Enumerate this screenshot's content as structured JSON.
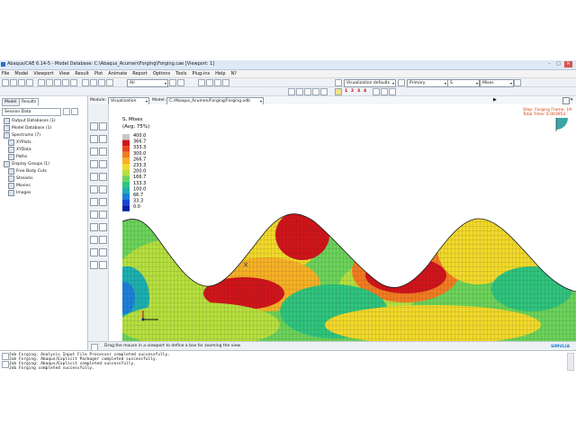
{
  "window": {
    "title": "Abaqus/CAE 6.14-5 - Model Database: C:\\Abaqus_Acumen\\Forging\\Forging.cae [Viewport: 1]",
    "minimize": "–",
    "maximize": "□",
    "close": "✕"
  },
  "menubar": [
    "File",
    "Model",
    "Viewport",
    "View",
    "Result",
    "Plot",
    "Animate",
    "Report",
    "Options",
    "Tools",
    "Plug-ins",
    "Help",
    "N?"
  ],
  "toolbar": {
    "all_select": "All",
    "visualization_defaults": "Visualization defaults",
    "primary": "Primary",
    "variable_s": "S",
    "mises": "Mises",
    "step_numbers": [
      "1",
      "2",
      "3",
      "4"
    ]
  },
  "context": {
    "module_label": "Module:",
    "module_value": "Visualization",
    "model_label": "Model:",
    "model_value": "C:/Abaqus_Acumen/Forging/Forging.odb"
  },
  "left_panel": {
    "tabs": [
      "Model",
      "Results"
    ],
    "session_label": "Session Data",
    "tree": [
      {
        "label": "Output Databases (1)",
        "child": false
      },
      {
        "label": "Model Database (1)",
        "child": false
      },
      {
        "label": "Spectrums (7)",
        "child": false
      },
      {
        "label": "XYPlots",
        "child": true
      },
      {
        "label": "XYData",
        "child": true
      },
      {
        "label": "Paths",
        "child": true
      },
      {
        "label": "Display Groups (1)",
        "child": false
      },
      {
        "label": "Free Body Cuts",
        "child": true
      },
      {
        "label": "Streams",
        "child": true
      },
      {
        "label": "Movies",
        "child": true
      },
      {
        "label": "Images",
        "child": true
      }
    ]
  },
  "legend": {
    "title": "S, Mises",
    "subtitle": "(Avg: 75%)",
    "levels": [
      "400.0",
      "366.7",
      "333.3",
      "300.0",
      "266.7",
      "233.3",
      "200.0",
      "166.7",
      "133.3",
      "100.0",
      "66.7",
      "33.3",
      "0.0"
    ],
    "colors": [
      "#c8c8c8",
      "#d0141a",
      "#e8461c",
      "#f37c20",
      "#f7b124",
      "#f2d929",
      "#b6e03d",
      "#6bd35a",
      "#2fc47d",
      "#1bb0b0",
      "#1b7fd8",
      "#1547d2",
      "#0a1fa8"
    ]
  },
  "step_info": {
    "line1": "Step: Forging   Frame: 19",
    "line2": "Total Time: 0.003953"
  },
  "status_prompt": "Drag the mouse in a viewport to define a box for zooming the view",
  "brand": "SIMULIA",
  "messages": [
    "Job Forging: Analysis Input File Processor completed successfully.",
    "Job Forging: Abaqus/Explicit Packager completed successfully.",
    "Job Forging: Abaqus/Explicit completed successfully.",
    "Job Forging completed successfully."
  ]
}
